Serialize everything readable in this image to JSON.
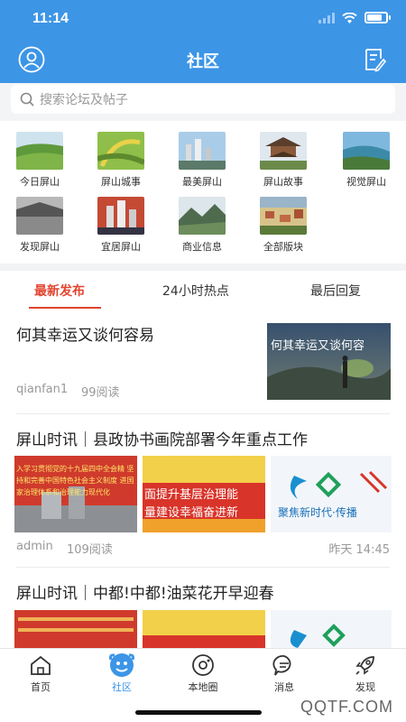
{
  "status": {
    "time": "11:14"
  },
  "header": {
    "title": "社区"
  },
  "search": {
    "placeholder": "搜索论坛及帖子"
  },
  "categories": [
    {
      "label": "今日屏山"
    },
    {
      "label": "屏山城事"
    },
    {
      "label": "最美屏山"
    },
    {
      "label": "屏山故事"
    },
    {
      "label": "视觉屏山"
    },
    {
      "label": "发现屏山"
    },
    {
      "label": "宜居屏山"
    },
    {
      "label": "商业信息"
    },
    {
      "label": "全部版块"
    }
  ],
  "tabs": [
    {
      "label": "最新发布",
      "active": true
    },
    {
      "label": "24小时热点"
    },
    {
      "label": "最后回复"
    }
  ],
  "posts": [
    {
      "title": "何其幸运又谈何容易",
      "author": "qianfan1",
      "reads": "99阅读",
      "thumb_text": "何其幸运又谈何容"
    },
    {
      "title": "屏山时讯｜县政协书画院部署今年重点工作",
      "author": "admin",
      "reads": "109阅读",
      "time": "昨天 14:45",
      "banner1": "入学习贯彻党的十九届四中全会精 坚持和完善中国特色社会主义制度 进国家治理体系和治理能力现代化",
      "banner2a": "面提升基层治理能",
      "banner2b": "量建设幸福奋进新",
      "banner3": "聚焦新时代·传播"
    },
    {
      "title": "屏山时讯｜中都!中都!油菜花开早迎春"
    }
  ],
  "bottom_nav": [
    {
      "label": "首页"
    },
    {
      "label": "社区",
      "active": true
    },
    {
      "label": "本地圈"
    },
    {
      "label": "消息"
    },
    {
      "label": "发现"
    }
  ],
  "watermark": "QQTF.COM",
  "colors": {
    "brand": "#3d95e6",
    "accent": "#e2442f"
  }
}
